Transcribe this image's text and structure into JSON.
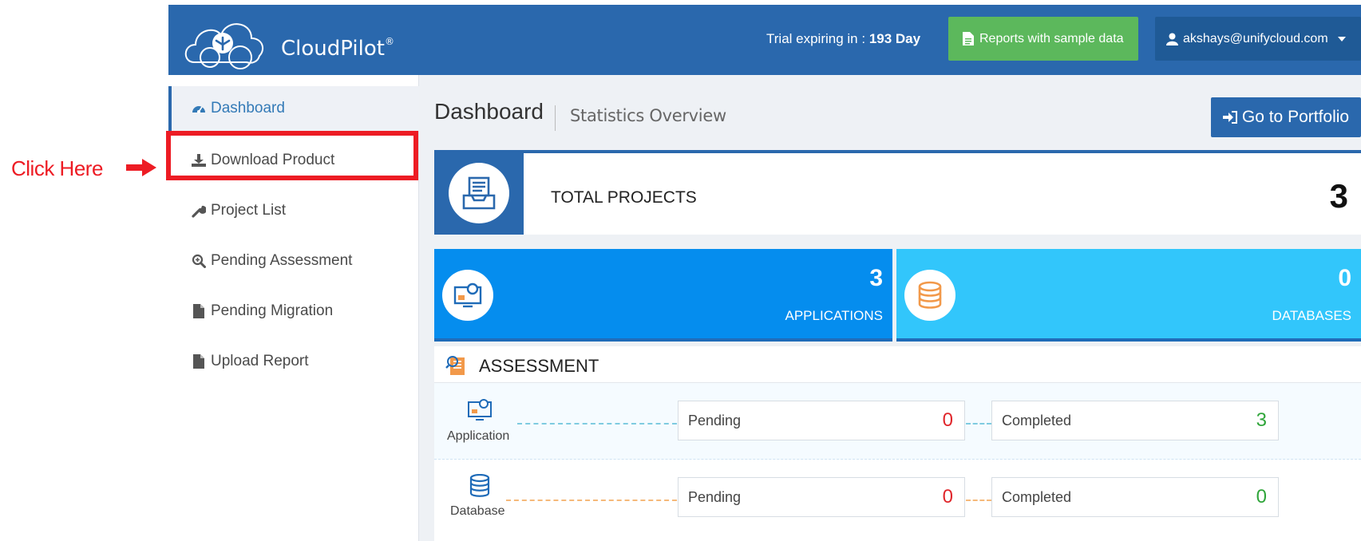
{
  "annotation": {
    "text": "Click Here",
    "color": "#ed1c24"
  },
  "header": {
    "logo_text": "CloudPilot",
    "logo_mark": "®",
    "trial_prefix": "Trial expiring in : ",
    "trial_days": "193 Day",
    "reports_button": "Reports with sample data",
    "user_email": "akshays@unifycloud.com"
  },
  "sidebar": {
    "items": [
      {
        "label": "Dashboard",
        "icon": "dashboard-icon"
      },
      {
        "label": "Download Product",
        "icon": "download-icon"
      },
      {
        "label": "Project List",
        "icon": "wrench-icon"
      },
      {
        "label": "Pending Assessment",
        "icon": "search-plus-icon"
      },
      {
        "label": "Pending Migration",
        "icon": "file-icon"
      },
      {
        "label": "Upload Report",
        "icon": "file-icon"
      }
    ]
  },
  "main": {
    "title": "Dashboard",
    "subtitle": "Statistics Overview",
    "portfolio_button": "Go to Portfolio",
    "total_projects": {
      "label": "TOTAL PROJECTS",
      "value": "3"
    },
    "applications": {
      "label": "APPLICATIONS",
      "value": "3"
    },
    "databases": {
      "label": "DATABASES",
      "value": "0"
    },
    "assessment": {
      "title": "ASSESSMENT",
      "rows": [
        {
          "label": "Application",
          "pending_label": "Pending",
          "pending": "0",
          "completed_label": "Completed",
          "completed": "3"
        },
        {
          "label": "Database",
          "pending_label": "Pending",
          "pending": "0",
          "completed_label": "Completed",
          "completed": "0"
        }
      ]
    }
  },
  "colors": {
    "header": "#2a68ad",
    "green": "#5cb85c",
    "app_card": "#058dee",
    "db_card": "#32c6fb",
    "pending": "#e0262b",
    "completed": "#2fa53a"
  }
}
